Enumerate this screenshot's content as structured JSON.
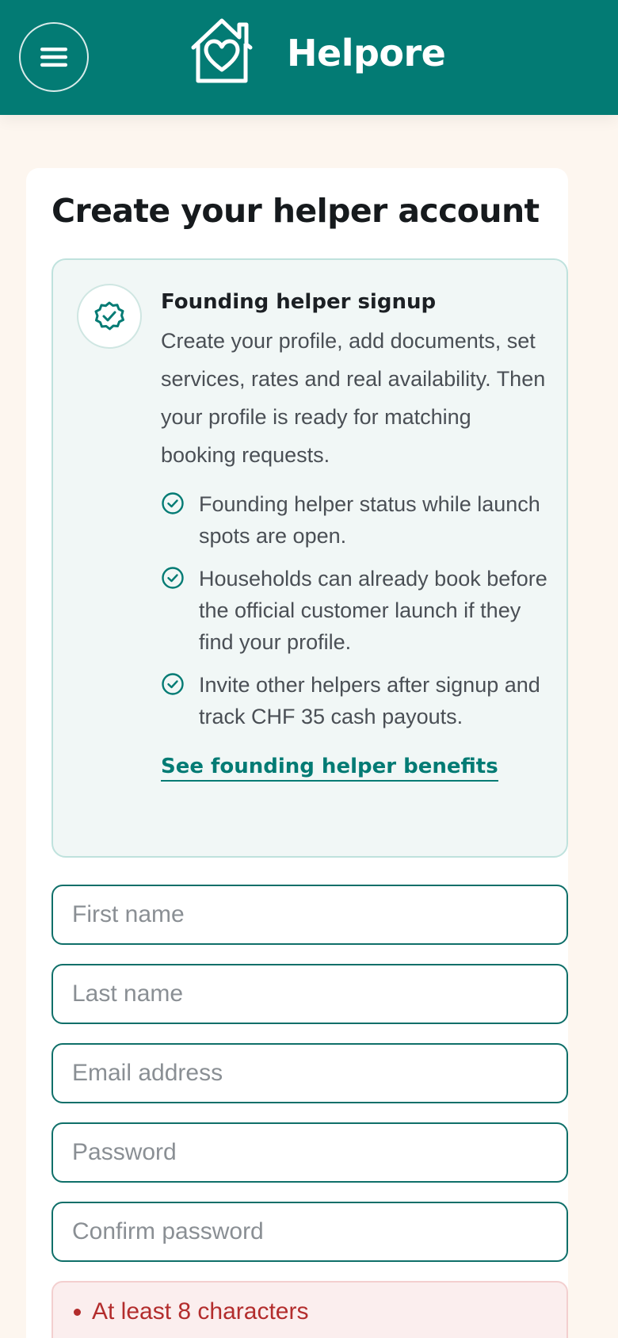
{
  "header": {
    "brand": "Helpore",
    "menu_icon": "hamburger-menu-icon",
    "logo_icon": "house-heart-icon",
    "bg_color": "#037b74"
  },
  "signup": {
    "title": "Create your helper account",
    "info": {
      "badge_icon": "verified-badge-icon",
      "title": "Founding helper signup",
      "description": "Create your profile, add documents, set services, rates and real availability. Then your profile is ready for matching booking requests.",
      "bullets": [
        "Founding helper status while launch spots are open.",
        "Households can already book before the official customer launch if they find your profile.",
        "Invite other helpers after signup and track CHF 35 cash payouts."
      ],
      "link": "See founding helper benefits"
    },
    "fields": {
      "first_name": {
        "placeholder": "First name",
        "value": ""
      },
      "last_name": {
        "placeholder": "Last name",
        "value": ""
      },
      "email": {
        "placeholder": "Email address",
        "value": ""
      },
      "password": {
        "placeholder": "Password",
        "value": ""
      },
      "confirm_password": {
        "placeholder": "Confirm password",
        "value": ""
      }
    },
    "password_rules": [
      "At least 8 characters"
    ]
  },
  "colors": {
    "accent": "#037b74",
    "page_bg": "#fdf6ef",
    "info_bg": "#f1f7f6",
    "error": "#b32d2d"
  }
}
